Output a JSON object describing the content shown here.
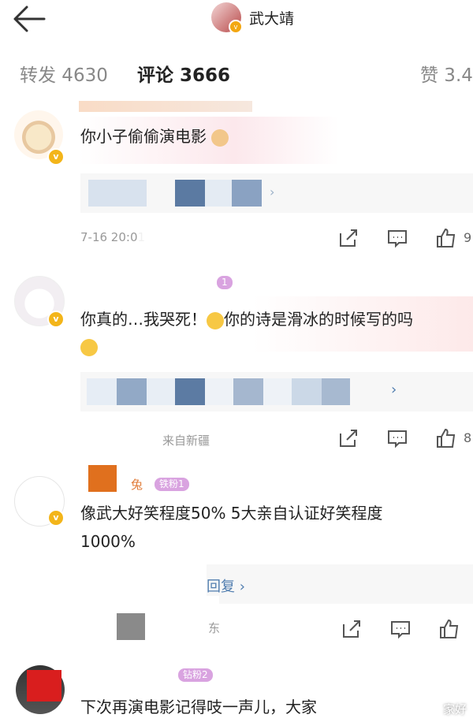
{
  "header": {
    "back_icon": "arrow-left-icon",
    "username": "武大靖"
  },
  "tabs": [
    {
      "label": "转发 4630"
    },
    {
      "label": "评论 3666"
    },
    {
      "label": "赞 3.4"
    }
  ],
  "comments": [
    {
      "text": "你小子偷偷演电影",
      "meta": "7-16 20:01",
      "like_count": "9"
    },
    {
      "fan_badge": "1",
      "text_line1": "你真的…我哭死！",
      "text_line1b": "你的诗是滑冰的时候写的吗",
      "meta": "来自新疆",
      "like_count": "8"
    },
    {
      "nick": "兔",
      "fan_badge": "铁粉1",
      "text_line1": "像武大好笑程度50% 5大亲自认证好笑程度",
      "text_line2": "1000%",
      "reply_label": "回复 ›",
      "meta": "东"
    },
    {
      "fan_badge": "钻粉2",
      "text_line1": "下次再演电影记得吱一声儿，大家"
    }
  ],
  "colors": {
    "accent": "#507daf",
    "vip_gold": "#f3b51a"
  },
  "watermark": "家好"
}
